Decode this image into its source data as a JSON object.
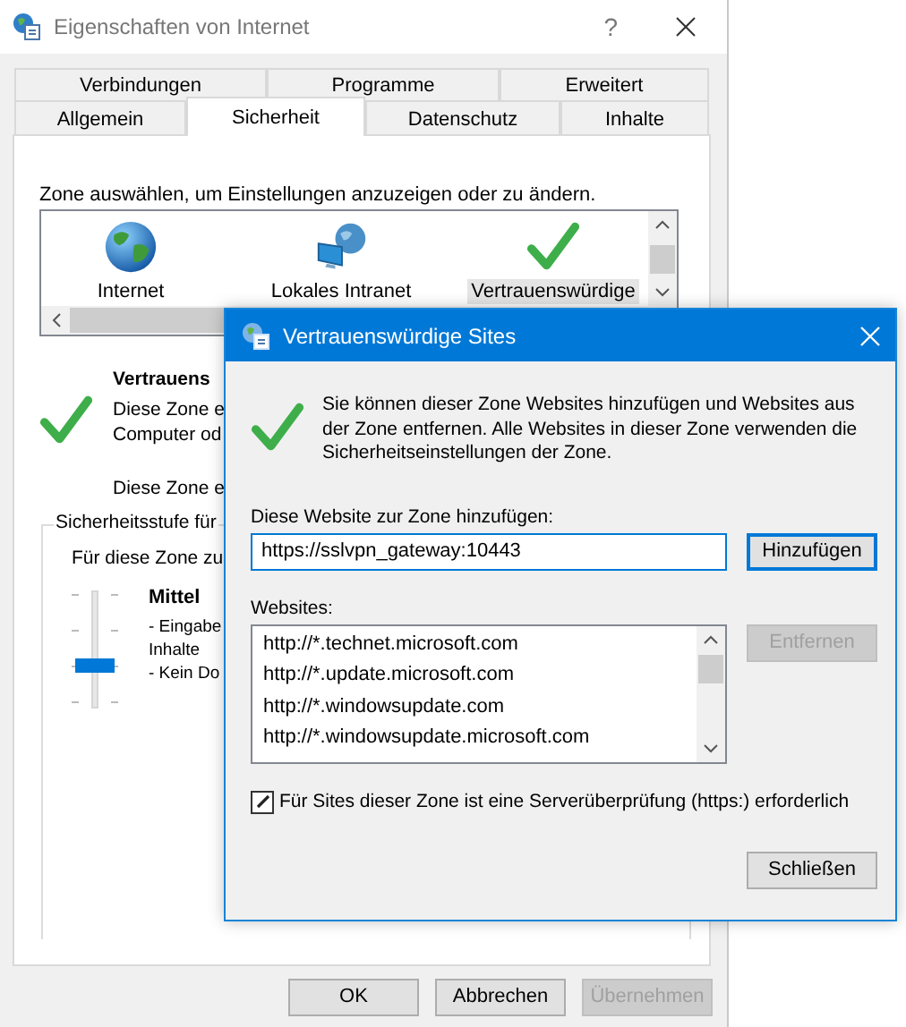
{
  "window": {
    "title": "Eigenschaften von Internet",
    "help": "?"
  },
  "tab_rows": [
    {
      "tabs": [
        {
          "label": "Verbindungen",
          "selected": false
        },
        {
          "label": "Programme",
          "selected": false
        },
        {
          "label": "Erweitert",
          "selected": false
        }
      ]
    },
    {
      "tabs": [
        {
          "label": "Allgemein",
          "selected": false
        },
        {
          "label": "Sicherheit",
          "selected": true
        },
        {
          "label": "Datenschutz",
          "selected": false
        },
        {
          "label": "Inhalte",
          "selected": false
        }
      ]
    }
  ],
  "zone_prompt": "Zone auswählen, um Einstellungen anzuzeigen oder zu ändern.",
  "zones": [
    {
      "kind": "globe",
      "label": "Internet",
      "selected": false
    },
    {
      "kind": "intranet",
      "label": "Lokales Intranet",
      "selected": false
    },
    {
      "kind": "check",
      "label": "Vertrauenswürdige",
      "selected": true
    }
  ],
  "zone_info": {
    "title": "Vertrauens",
    "lines": [
      "Diese Zone e",
      "Computer od"
    ],
    "note": "Diese Zone e"
  },
  "security_level": {
    "group_title": "Sicherheitsstufe für",
    "prompt": "Für diese Zone zu",
    "level": 0.33,
    "level_name": "Mittel",
    "details": [
      "- Eingabe",
      "Inhalte",
      "- Kein Do"
    ]
  },
  "buttons": [
    {
      "label": "OK",
      "disabled": false
    },
    {
      "label": "Abbrechen",
      "disabled": false
    },
    {
      "label": "Übernehmen",
      "disabled": true
    }
  ],
  "dialog": {
    "title": "Vertrauenswürdige Sites",
    "description": "Sie können dieser Zone Websites hinzufügen und Websites aus der Zone entfernen. Alle Websites in dieser Zone verwenden die Sicherheitseinstellungen der Zone.",
    "add_label": "Diese Website zur Zone hinzufügen:",
    "add_value": "https://sslvpn_gateway:10443",
    "add_button": {
      "label": "Hinzufügen",
      "default": true
    },
    "websites_label": "Websites:",
    "websites": [
      "http://*.technet.microsoft.com",
      "http://*.update.microsoft.com",
      "http://*.windowsupdate.com",
      "http://*.windowsupdate.microsoft.com"
    ],
    "remove_button": {
      "label": "Entfernen",
      "disabled": true
    },
    "https_check": {
      "label": "Für Sites dieser Zone ist eine Serverüberprüfung (https:) erforderlich",
      "checked": true
    },
    "close_button": {
      "label": "Schließen",
      "default": false
    }
  }
}
